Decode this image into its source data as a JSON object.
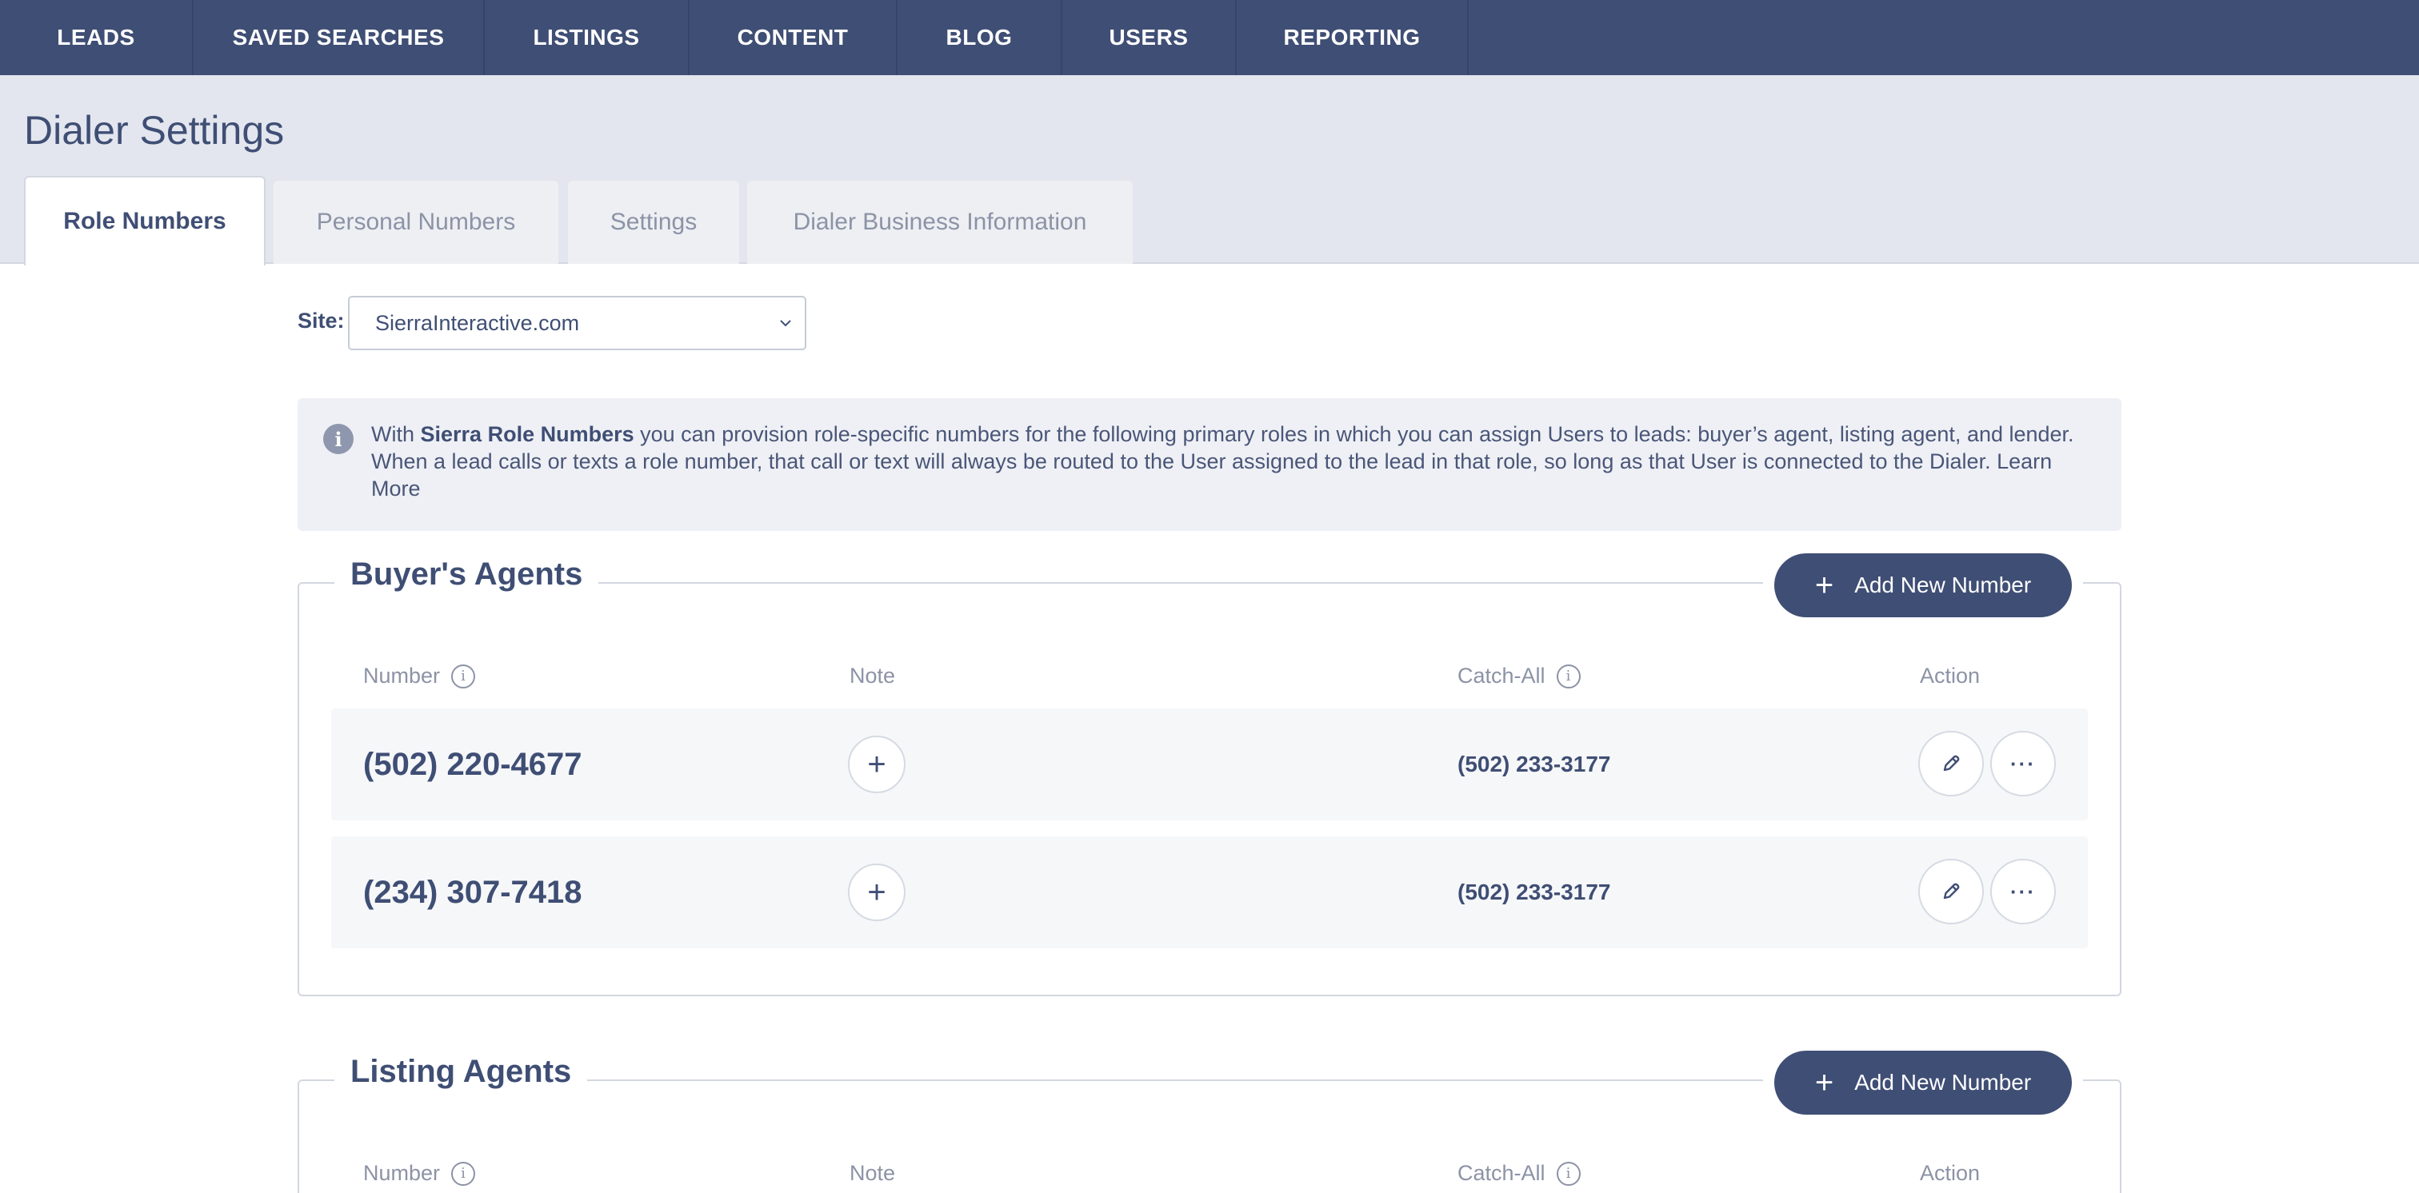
{
  "nav": {
    "items": [
      "LEADS",
      "SAVED SEARCHES",
      "LISTINGS",
      "CONTENT",
      "BLOG",
      "USERS",
      "REPORTING"
    ]
  },
  "page": {
    "title": "Dialer Settings"
  },
  "tabs": [
    "Role Numbers",
    "Personal Numbers",
    "Settings",
    "Dialer Business Information"
  ],
  "site": {
    "label": "Site:",
    "value": "SierraInteractive.com"
  },
  "info": {
    "prefix": "With ",
    "bold": "Sierra Role Numbers",
    "body": " you can provision role-specific numbers for the following primary roles in which you can assign Users to leads: buyer’s agent, listing agent, and lender. When a lead calls or texts a role number, that call or text will always be routed to the User assigned to the lead in that role, so long as that User is connected to the Dialer.  ",
    "link": "Learn More"
  },
  "columns": {
    "number": "Number",
    "note": "Note",
    "catch_all": "Catch-All",
    "action": "Action"
  },
  "add_button_label": "Add New Number",
  "sections": {
    "buyers": {
      "title": "Buyer's Agents",
      "rows": [
        {
          "number": "(502) 220-4677",
          "catch_all": "(502) 233-3177"
        },
        {
          "number": "(234) 307-7418",
          "catch_all": "(502) 233-3177"
        }
      ]
    },
    "listing": {
      "title": "Listing Agents"
    }
  },
  "icons": {
    "info": "info-icon",
    "plus": "plus-icon",
    "edit": "pencil-icon",
    "more": "ellipsis-icon",
    "select": "chevron-down-icon"
  },
  "colors": {
    "nav_bg": "#3f4e74",
    "header_bg": "#e3e6ee",
    "accent": "#3f4e74"
  }
}
